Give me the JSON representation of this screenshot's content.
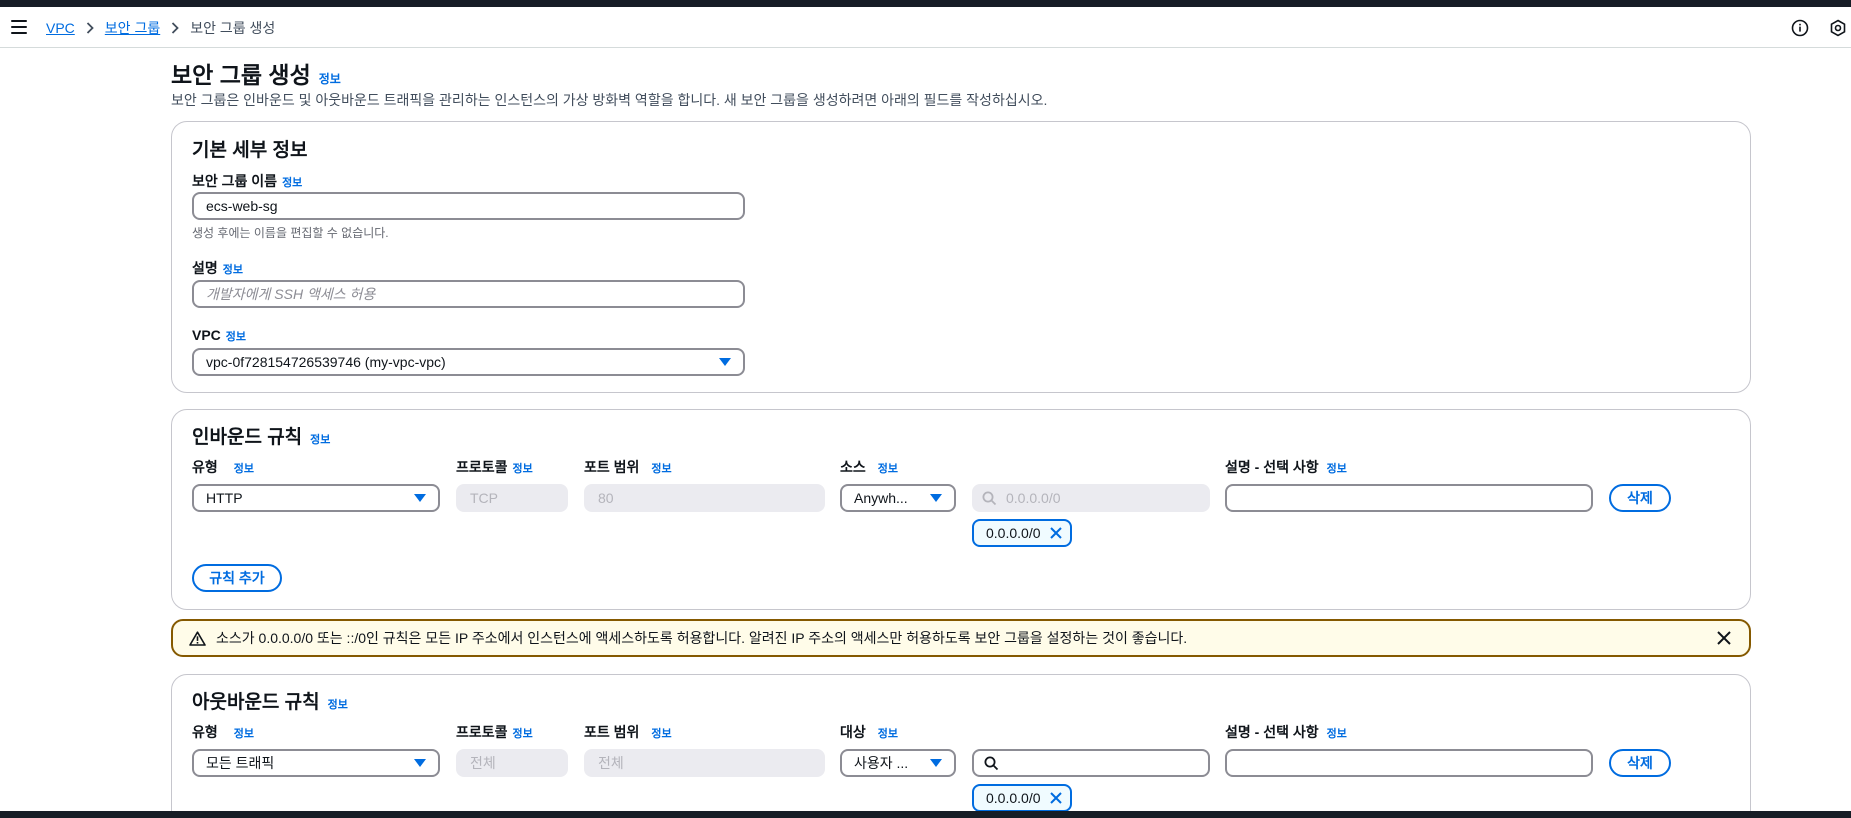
{
  "breadcrumb": {
    "items": [
      "VPC",
      "보안 그룹"
    ],
    "current": "보안 그룹 생성"
  },
  "page": {
    "title": "보안 그룹 생성",
    "info": "정보",
    "description": "보안 그룹은 인바운드 및 아웃바운드 트래픽을 관리하는 인스턴스의 가상 방화벽 역할을 합니다. 새 보안 그룹을 생성하려면 아래의 필드를 작성하십시오."
  },
  "basic": {
    "title": "기본 세부 정보",
    "name_label": "보안 그룹 이름",
    "name_value": "ecs-web-sg",
    "name_hint": "생성 후에는 이름을 편집할 수 없습니다.",
    "desc_label": "설명",
    "desc_placeholder": "개발자에게 SSH 액세스 허용",
    "vpc_label": "VPC",
    "vpc_value": "vpc-0f728154726539746 (my-vpc-vpc)"
  },
  "inbound": {
    "title": "인바운드 규칙",
    "col_type": "유형",
    "col_protocol": "프로토콜",
    "col_port": "포트 범위",
    "col_source": "소스",
    "col_desc": "설명 - 선택 사항",
    "type_value": "HTTP",
    "protocol_value": "TCP",
    "port_value": "80",
    "source_value": "Anywh...",
    "cidr_placeholder": "0.0.0.0/0",
    "token": "0.0.0.0/0",
    "delete_label": "삭제",
    "add_rule_label": "규칙 추가"
  },
  "alert": {
    "text": "소스가 0.0.0.0/0 또는 ::/0인 규칙은 모든 IP 주소에서 인스턴스에 액세스하도록 허용합니다. 알려진 IP 주소의 액세스만 허용하도록 보안 그룹을 설정하는 것이 좋습니다."
  },
  "outbound": {
    "title": "아웃바운드 규칙",
    "col_type": "유형",
    "col_protocol": "프로토콜",
    "col_port": "포트 범위",
    "col_dest": "대상",
    "col_desc": "설명 - 선택 사항",
    "type_value": "모든 트래픽",
    "protocol_value": "전체",
    "port_value": "전체",
    "dest_value": "사용자 ...",
    "token": "0.0.0.0/0",
    "delete_label": "삭제"
  },
  "info_text": "정보",
  "colors": {
    "link": "#006ce0",
    "warning_border": "#855900",
    "warning_bg": "#fffce9"
  }
}
